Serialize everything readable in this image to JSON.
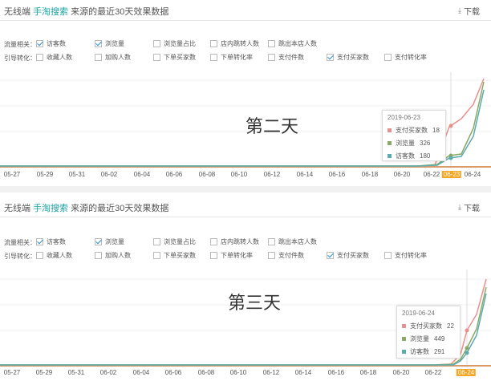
{
  "panels": [
    {
      "title_prefix": "无线端",
      "title_highlight": "手淘搜索",
      "title_suffix": "来源的最近30天效果数据",
      "download_label": "下载",
      "row1_label": "流量相关：",
      "row2_label": "引导转化：",
      "row1_options": [
        {
          "label": "访客数",
          "checked": true
        },
        {
          "label": "浏览量",
          "checked": true
        },
        {
          "label": "浏览量占比",
          "checked": false
        },
        {
          "label": "店内跳转人数",
          "checked": false
        },
        {
          "label": "跳出本店人数",
          "checked": false
        }
      ],
      "row2_options": [
        {
          "label": "收藏人数",
          "checked": false
        },
        {
          "label": "加购人数",
          "checked": false
        },
        {
          "label": "下单买家数",
          "checked": false
        },
        {
          "label": "下单转化率",
          "checked": false
        },
        {
          "label": "支付件数",
          "checked": false
        },
        {
          "label": "支付买家数",
          "checked": true
        },
        {
          "label": "支付转化率",
          "checked": false
        }
      ],
      "overlay": "第二天",
      "x_labels": [
        "05-27",
        "05-29",
        "05-31",
        "06-02",
        "06-04",
        "06-06",
        "06-08",
        "06-10",
        "06-12",
        "06-14",
        "06-16",
        "06-18",
        "06-20",
        "06-22",
        "06-23",
        "06-24"
      ],
      "active_label": "06-23",
      "tooltip": {
        "date": "2019-06-23",
        "rows": [
          {
            "name": "支付买家数",
            "value": "18",
            "color": "#e8908e"
          },
          {
            "name": "浏览量",
            "value": "326",
            "color": "#8aa866"
          },
          {
            "name": "访客数",
            "value": "180",
            "color": "#5aabb0"
          }
        ]
      }
    },
    {
      "title_prefix": "无线端",
      "title_highlight": "手淘搜索",
      "title_suffix": "来源的最近30天效果数据",
      "download_label": "下载",
      "row1_label": "流量相关：",
      "row2_label": "引导转化：",
      "row1_options": [
        {
          "label": "访客数",
          "checked": true
        },
        {
          "label": "浏览量",
          "checked": true
        },
        {
          "label": "浏览量占比",
          "checked": false
        },
        {
          "label": "店内跳转人数",
          "checked": false
        },
        {
          "label": "跳出本店人数",
          "checked": false
        }
      ],
      "row2_options": [
        {
          "label": "收藏人数",
          "checked": false
        },
        {
          "label": "加购人数",
          "checked": false
        },
        {
          "label": "下单买家数",
          "checked": false
        },
        {
          "label": "下单转化率",
          "checked": false
        },
        {
          "label": "支付件数",
          "checked": false
        },
        {
          "label": "支付买家数",
          "checked": true
        },
        {
          "label": "支付转化率",
          "checked": false
        }
      ],
      "overlay": "第三天",
      "x_labels": [
        "05-27",
        "05-29",
        "05-31",
        "06-02",
        "06-04",
        "06-06",
        "06-08",
        "06-10",
        "06-12",
        "06-14",
        "06-16",
        "06-18",
        "06-20",
        "06-22",
        "06-24"
      ],
      "active_label": "06-24",
      "tooltip": {
        "date": "2019-06-24",
        "rows": [
          {
            "name": "支付买家数",
            "value": "22",
            "color": "#e8908e"
          },
          {
            "name": "浏览量",
            "value": "449",
            "color": "#8aa866"
          },
          {
            "name": "访客数",
            "value": "291",
            "color": "#5aabb0"
          }
        ]
      }
    }
  ]
}
